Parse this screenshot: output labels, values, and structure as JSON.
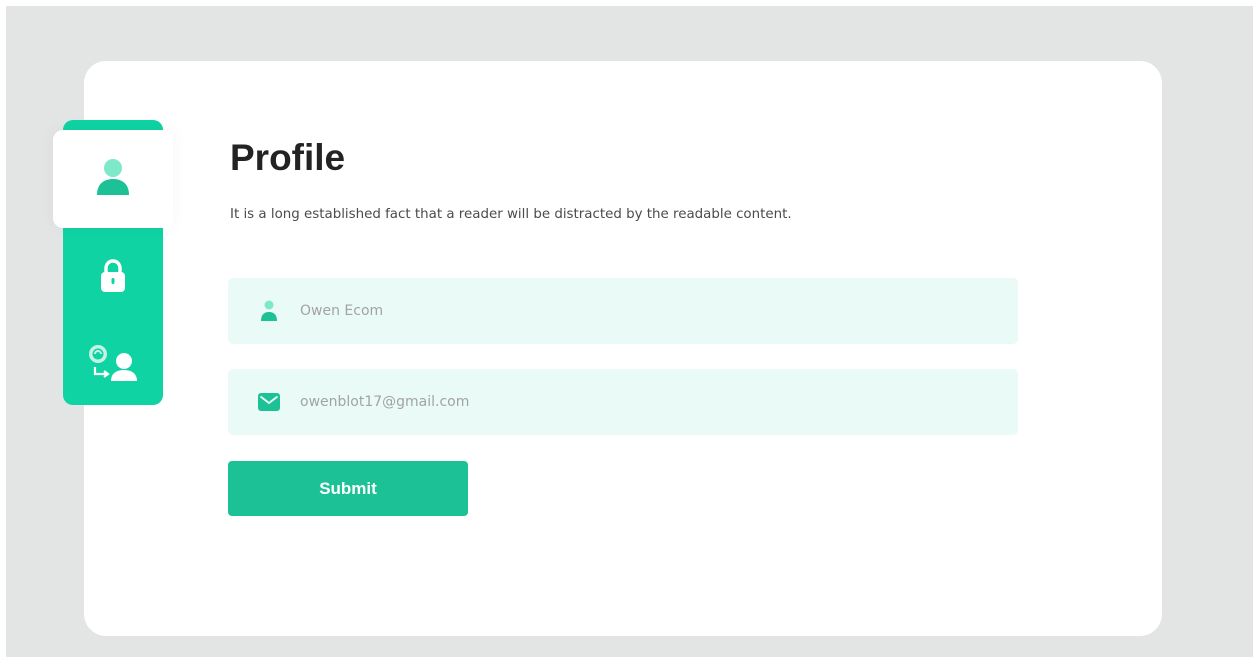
{
  "profile": {
    "title": "Profile",
    "description": "It is a long established fact that a reader will be distracted by the readable content."
  },
  "form": {
    "name_value": "Owen Ecom",
    "email_value": "owenblot17@gmail.com",
    "submit_label": "Submit"
  },
  "sidebar": {
    "items": [
      {
        "id": "profile",
        "icon": "user-icon",
        "active": true
      },
      {
        "id": "security",
        "icon": "lock-icon",
        "active": false
      },
      {
        "id": "switch-account",
        "icon": "switch-account-icon",
        "active": false
      }
    ]
  },
  "colors": {
    "accent": "#0fd3a3",
    "button": "#1dc196",
    "field_bg": "#eafaf7",
    "background": "#e3e5e4",
    "card": "#ffffff"
  }
}
